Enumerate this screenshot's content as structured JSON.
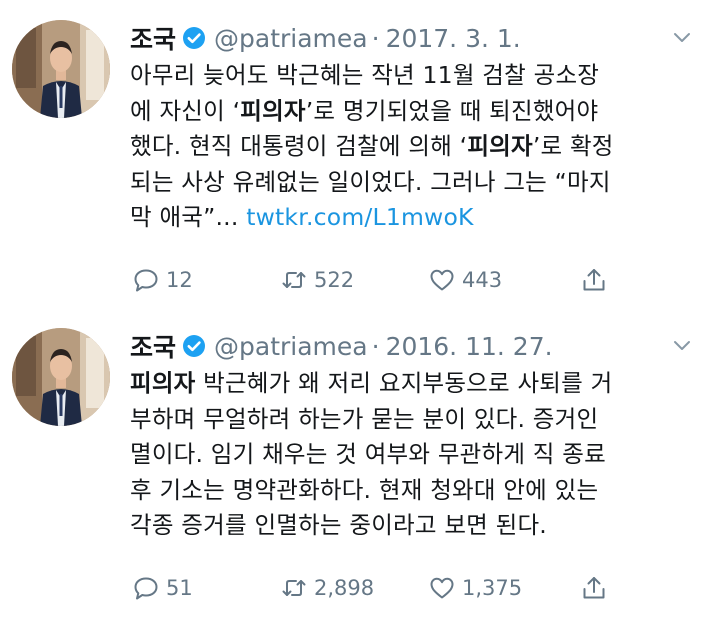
{
  "tweets": [
    {
      "author_name": "조국",
      "handle": "@patriamea",
      "separator": "·",
      "date": "2017. 3. 1.",
      "body": [
        {
          "text": "아무리 늦어도 박근혜는 작년 11월 검찰 공소장\n에 자신이 ‘",
          "style": "normal"
        },
        {
          "text": "피의자",
          "style": "bold"
        },
        {
          "text": "’로 명기되었을 때 퇴진했어야\n했다. 현직 대통령이 검찰에 의해 ‘",
          "style": "normal"
        },
        {
          "text": "피의자",
          "style": "bold"
        },
        {
          "text": "’로 확정\n되는 사상 유례없는 일이었다. 그러나 그는 “마지\n막 애국”... ",
          "style": "normal"
        },
        {
          "text": "twtkr.com/L1mwoK",
          "style": "link"
        }
      ],
      "replies": "12",
      "retweets": "522",
      "likes": "443"
    },
    {
      "author_name": "조국",
      "handle": "@patriamea",
      "separator": "·",
      "date": "2016. 11. 27.",
      "body": [
        {
          "text": "피의자",
          "style": "bold"
        },
        {
          "text": " 박근혜가 왜 저리 요지부동으로 사퇴를 거\n부하며 무얼하려 하는가 묻는 분이 있다. 증거인\n멸이다. 임기 채우는 것 여부와 무관하게 직 종료\n후 기소는 명약관화하다. 현재 청와대 안에 있는\n각종 증거를 인멸하는 중이라고 보면 된다.",
          "style": "normal"
        }
      ],
      "replies": "51",
      "retweets": "2,898",
      "likes": "1,375"
    }
  ],
  "icons": {
    "verified": "verified-badge-icon",
    "caret": "chevron-down-icon",
    "reply": "reply-icon",
    "retweet": "retweet-icon",
    "like": "heart-icon",
    "share": "share-icon"
  },
  "colors": {
    "text": "#14171a",
    "secondary": "#657786",
    "link": "#1b95e0",
    "verified": "#1da1f2"
  }
}
